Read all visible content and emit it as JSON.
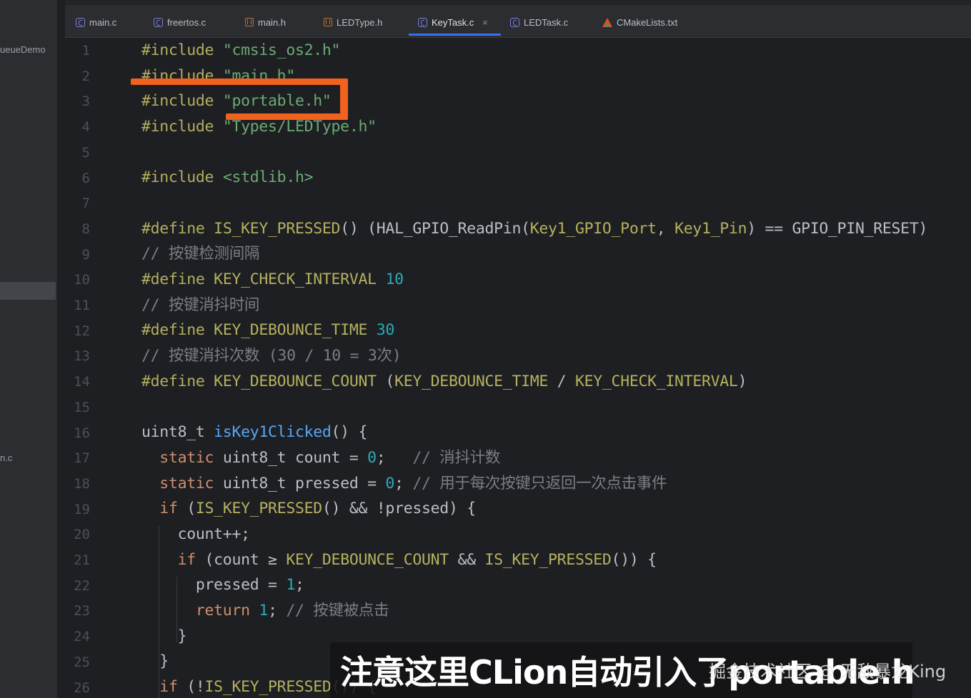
{
  "sidebar": {
    "project_label": "ueueDemo",
    "file_label": "n.c"
  },
  "tabs": [
    {
      "label": "main.c",
      "icon": "c-file-icon"
    },
    {
      "label": "freertos.c",
      "icon": "c-file-icon"
    },
    {
      "label": "main.h",
      "icon": "h-file-icon"
    },
    {
      "label": "LEDType.h",
      "icon": "h-file-icon"
    },
    {
      "label": "KeyTask.c",
      "icon": "c-file-icon",
      "active": true,
      "close": "×"
    },
    {
      "label": "LEDTask.c",
      "icon": "c-file-icon"
    },
    {
      "label": "CMakeLists.txt",
      "icon": "cmake-icon"
    }
  ],
  "code": {
    "line_numbers": [
      "1",
      "2",
      "3",
      "4",
      "5",
      "6",
      "7",
      "8",
      "9",
      "10",
      "11",
      "12",
      "13",
      "14",
      "15",
      "16",
      "17",
      "18",
      "19",
      "20",
      "21",
      "22",
      "23",
      "24",
      "25",
      "26"
    ],
    "l1": {
      "kw": "#include",
      "s": "\"cmsis_os2.h\""
    },
    "l2": {
      "kw": "#include",
      "s": "\"main.h\""
    },
    "l3": {
      "kw": "#include",
      "s": "\"portable.h\""
    },
    "l4": {
      "kw": "#include",
      "s": "\"Types/LEDType.h\""
    },
    "l6": {
      "kw": "#include",
      "s": "<stdlib.h>"
    },
    "l8": {
      "kw": "#define",
      "name": "IS_KEY_PRESSED",
      "t1": "() (HAL_GPIO_ReadPin(",
      "a1": "Key1_GPIO_Port",
      "t2": ", ",
      "a2": "Key1_Pin",
      "t3": ") == GPIO_PIN_RESET)"
    },
    "l9": {
      "c": "// 按键检测间隔"
    },
    "l10": {
      "kw": "#define",
      "name": "KEY_CHECK_INTERVAL",
      "n": "10"
    },
    "l11": {
      "c": "// 按键消抖时间"
    },
    "l12": {
      "kw": "#define",
      "name": "KEY_DEBOUNCE_TIME",
      "n": "30"
    },
    "l13": {
      "c": "// 按键消抖次数 (30 / 10 = 3次)"
    },
    "l14": {
      "kw": "#define",
      "name": "KEY_DEBOUNCE_COUNT",
      "t1": " (",
      "a1": "KEY_DEBOUNCE_TIME",
      "t2": " / ",
      "a2": "KEY_CHECK_INTERVAL",
      "t3": ")"
    },
    "l16": {
      "t1": "uint8_t ",
      "fn": "isKey1Clicked",
      "t2": "() {"
    },
    "l17": {
      "kw": "static",
      "t1": " uint8_t count = ",
      "n": "0",
      "t2": ";   ",
      "c": "// 消抖计数"
    },
    "l18": {
      "kw": "static",
      "t1": " uint8_t pressed = ",
      "n": "0",
      "t2": "; ",
      "c": "// 用于每次按键只返回一次点击事件"
    },
    "l19": {
      "kw": "if",
      "t1": " (",
      "m": "IS_KEY_PRESSED",
      "t2": "() && !pressed) {"
    },
    "l20": {
      "t1": "count++;"
    },
    "l21": {
      "kw": "if",
      "t1": " (count ≥ ",
      "m": "KEY_DEBOUNCE_COUNT",
      "t2": " && ",
      "m2": "IS_KEY_PRESSED",
      "t3": "()) {"
    },
    "l22": {
      "t1": "pressed = ",
      "n": "1",
      "t2": ";"
    },
    "l23": {
      "kw": "return",
      "t1": " ",
      "n": "1",
      "t2": "; ",
      "c": "// 按键被点击"
    },
    "l24": {
      "t1": "}"
    },
    "l25": {
      "t1": "}"
    },
    "l26": {
      "kw": "if",
      "t1": " (!",
      "m": "IS_KEY_PRESSED",
      "t2": "()) {"
    }
  },
  "subtitle": "注意这里CLion自动引入了portable.h",
  "watermark": "掘金技术社区 @ 无敌暴龙King",
  "colors": {
    "annotation": "#f0621e",
    "keyword": "#cf8e6d",
    "string": "#6aab73",
    "macro": "#b5b15f",
    "number": "#2aacb8",
    "comment": "#7a7e85",
    "function": "#56a8f5",
    "tab_active_underline": "#3574f0"
  }
}
